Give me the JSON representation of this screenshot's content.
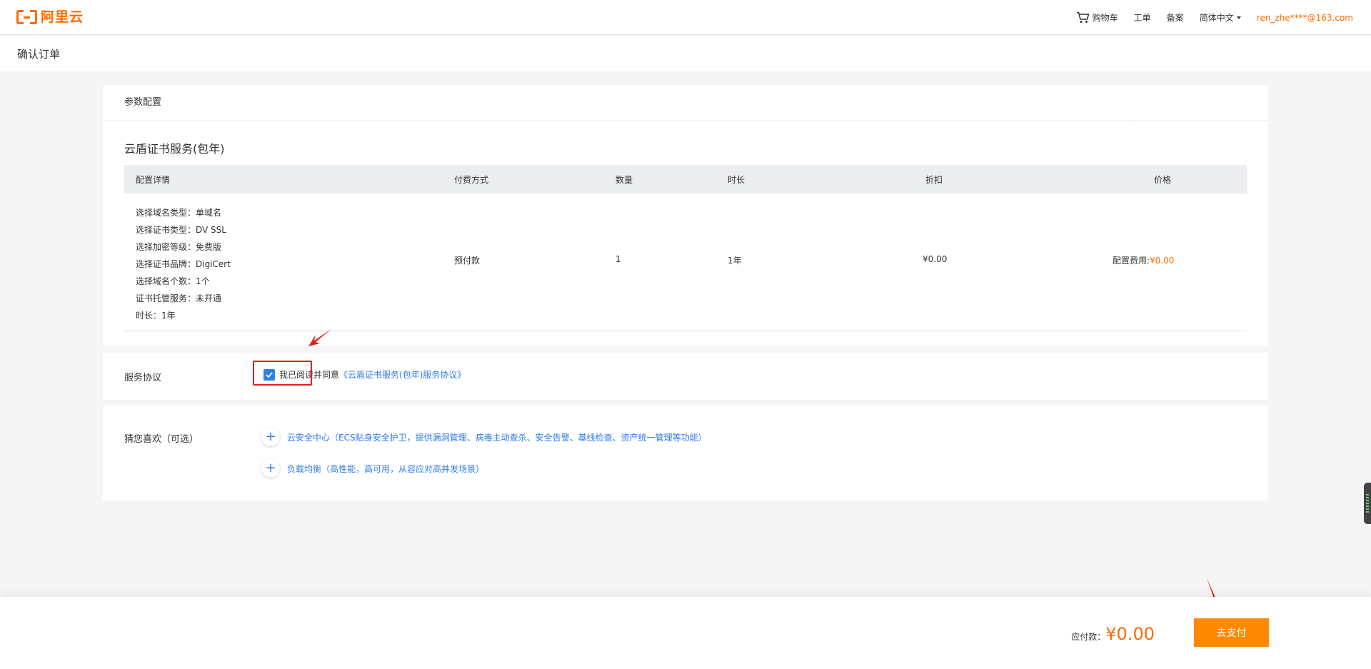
{
  "header": {
    "logo_text": "阿里云",
    "nav": {
      "cart": "购物车",
      "ticket": "工单",
      "record": "备案",
      "language": "简体中文",
      "user": "ren_zhe****@163.com"
    }
  },
  "page": {
    "title": "确认订单"
  },
  "config_panel": {
    "heading": "参数配置",
    "product_name": "云盾证书服务(包年)",
    "table": {
      "headers": [
        "配置详情",
        "付费方式",
        "数量",
        "时长",
        "折扣",
        "价格"
      ],
      "config_lines": [
        "选择域名类型：单域名",
        "选择证书类型：DV SSL",
        "选择加密等级：免费版",
        "选择证书品牌：DigiCert",
        "选择域名个数：1个",
        "证书托管服务：未开通",
        "时长：1年"
      ],
      "payment_method": "预付款",
      "quantity": "1",
      "duration": "1年",
      "discount": "¥0.00",
      "price_label": "配置费用:",
      "price_value": "¥0.00"
    }
  },
  "agreement_panel": {
    "label": "服务协议",
    "checked": true,
    "agree_text": "我已阅读并同意",
    "link_text": "《云盾证书服务(包年)服务协议》"
  },
  "recommend_panel": {
    "label": "猜您喜欢（可选）",
    "items": [
      "云安全中心（ECS贴身安全护卫，提供漏洞管理、病毒主动查杀、安全告警、基线检查、资产统一管理等功能）",
      "负载均衡（高性能，高可用，从容应对高并发场景）"
    ]
  },
  "footer": {
    "due_label": "应付款：",
    "due_amount": "¥0.00",
    "pay_button": "去支付"
  },
  "colors": {
    "accent": "#ff6a00",
    "link": "#2f7be8",
    "annotation": "#e02020"
  }
}
